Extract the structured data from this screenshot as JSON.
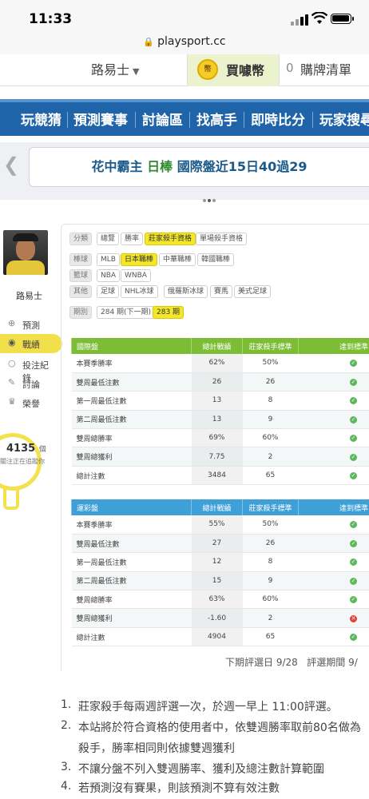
{
  "status_bar": {
    "time": "11:33"
  },
  "browser": {
    "url": "playsport.cc"
  },
  "topbar": {
    "username": "路易士",
    "coin_icon_text": "幣",
    "buy_coins": "買噱幣",
    "cart_count": "0",
    "cart_label": "購牌清單"
  },
  "nav": {
    "items": [
      "玩競猜",
      "預測賽事",
      "討論區",
      "找高手",
      "即時比分",
      "玩家搜尋"
    ]
  },
  "announcement": {
    "prefix": "花中霸主",
    "league": "日棒",
    "text": "國際盤近15日40過29"
  },
  "profile": {
    "name": "路易士",
    "menu": [
      {
        "label": "預測",
        "icon": "target-icon"
      },
      {
        "label": "戰績",
        "icon": "chat-icon"
      },
      {
        "label": "投注紀錄",
        "icon": "circle-icon"
      },
      {
        "label": "討論",
        "icon": "edit-icon"
      },
      {
        "label": "榮譽",
        "icon": "trophy-icon"
      }
    ],
    "points": "4135",
    "points_unit": "個",
    "points_note": "關注正在追蹤你"
  },
  "filters": {
    "category": {
      "label": "分類",
      "items": [
        "總覽",
        "勝率",
        "莊家殺手資格",
        "單場殺手資格"
      ],
      "selected": 2
    },
    "baseball": {
      "label": "棒球",
      "items": [
        "MLB",
        "日本職棒",
        "中華職棒",
        "韓國職棒"
      ],
      "selected": 1
    },
    "basketball": {
      "label": "籃球",
      "items": [
        "NBA",
        "WNBA"
      ]
    },
    "other": {
      "label": "其他",
      "items": [
        "足球",
        "NHL冰球",
        "俄羅斯冰球",
        "賽馬",
        "美式足球"
      ]
    },
    "period": {
      "label": "期別",
      "items": [
        "284 期(下一期)",
        "283 期"
      ],
      "selected": 1
    }
  },
  "table_international": {
    "headers": [
      "國際盤",
      "總計戰績",
      "莊家殺手標準",
      "達到標準"
    ],
    "rows": [
      {
        "label": "本賽季勝率",
        "value": "62%",
        "standard": "50%",
        "met": true
      },
      {
        "label": "雙周最低注數",
        "value": "26",
        "standard": "26",
        "met": true
      },
      {
        "label": "第一周最低注數",
        "value": "13",
        "standard": "8",
        "met": true
      },
      {
        "label": "第二周最低注數",
        "value": "13",
        "standard": "9",
        "met": true
      },
      {
        "label": "雙周總勝率",
        "value": "69%",
        "standard": "60%",
        "met": true
      },
      {
        "label": "雙周總獲利",
        "value": "7.75",
        "standard": "2",
        "met": true
      },
      {
        "label": "總計注數",
        "value": "3484",
        "standard": "65",
        "met": true
      }
    ]
  },
  "table_lottery": {
    "headers": [
      "運彩盤",
      "總計戰績",
      "莊家殺手標準",
      "達到標準"
    ],
    "rows": [
      {
        "label": "本賽季勝率",
        "value": "55%",
        "standard": "50%",
        "met": true
      },
      {
        "label": "雙周最低注數",
        "value": "27",
        "standard": "26",
        "met": true
      },
      {
        "label": "第一周最低注數",
        "value": "12",
        "standard": "8",
        "met": true
      },
      {
        "label": "第二周最低注數",
        "value": "15",
        "standard": "9",
        "met": true
      },
      {
        "label": "雙周總勝率",
        "value": "63%",
        "standard": "60%",
        "met": true
      },
      {
        "label": "雙周總獲利",
        "value": "-1.60",
        "standard": "2",
        "met": false
      },
      {
        "label": "總計注數",
        "value": "4904",
        "standard": "65",
        "met": true
      }
    ]
  },
  "evaluation": {
    "next_label": "下期評選日",
    "next_date": "9/28",
    "period_label": "評選期間",
    "period_value": "9/"
  },
  "rules": [
    "莊家殺手每兩週評選一次，於週一早上 11:00評選。",
    "本站將於符合資格的使用者中，依雙週勝率取前80名做為",
    "殺手，勝率相同則依據雙週獲利",
    "不讓分盤不列入雙週勝率、獲利及總注數計算範圍",
    "若預測沒有賽果，則該預測不算有效注數"
  ],
  "rule_numbers": [
    "1.",
    "2.",
    "3.",
    "4."
  ]
}
